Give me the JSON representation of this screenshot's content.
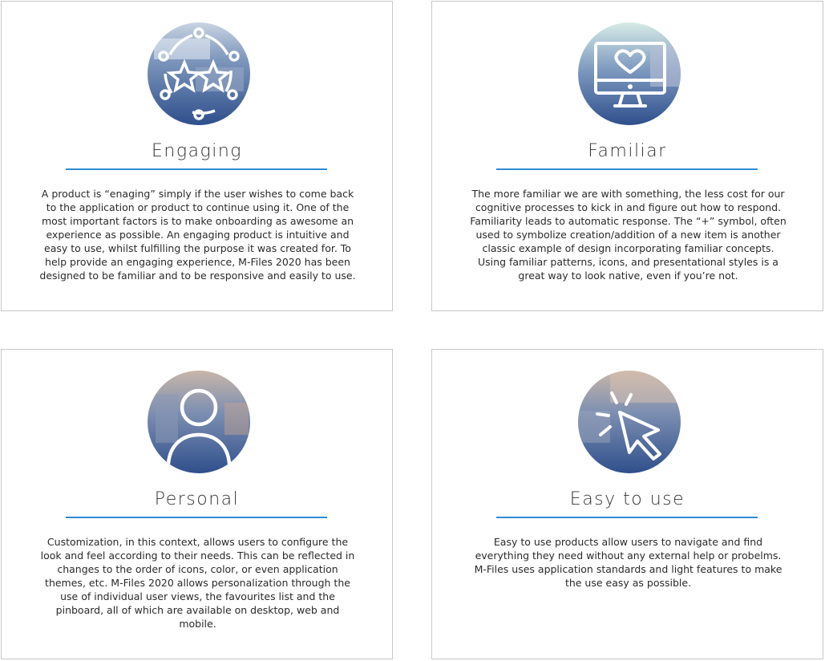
{
  "cards": [
    {
      "title": "Engaging",
      "icon": "stars-network-icon",
      "body": "A product is “enaging” simply if the user wishes to come back to the application or product to continue using it. One of the most important factors is to make onboarding as awesome an experience as possible. An engaging product is intuitive and easy to use, whilst fulfilling the purpose it was created for. To help provide an engaging experience, M-Files 2020 has been designed to be familiar and to be responsive and easily to use."
    },
    {
      "title": "Familiar",
      "icon": "monitor-heart-icon",
      "body": "The more familiar we are with something, the less cost for our cognitive processes to kick in and figure out how to respond. Familiarity leads to automatic response. The “+” symbol, often used to symbolize creation/addition of a new item is another classic example of design incorporating familiar concepts. Using familiar patterns, icons, and presentational styles is a great way to look native, even if you’re not."
    },
    {
      "title": "Personal",
      "icon": "user-icon",
      "body": "Customization, in this context, allows users to configure the look and feel according to their needs. This can be reflected in changes to the order of icons, color, or even application themes, etc. M-Files 2020 allows personalization through the use of individual user views, the favourites list and the pinboard, all of which are available on desktop, web and mobile."
    },
    {
      "title": "Easy to use",
      "icon": "cursor-click-icon",
      "body": "Easy to use products allow users to navigate and find everything they need without any external help or probelms. M-Files uses application standards and light features to make the use easy as possible."
    }
  ],
  "colors": {
    "accent_rule": "#2e8bd2",
    "card_border": "#c8c8c8",
    "medallion_blue": "#3e5f97"
  }
}
